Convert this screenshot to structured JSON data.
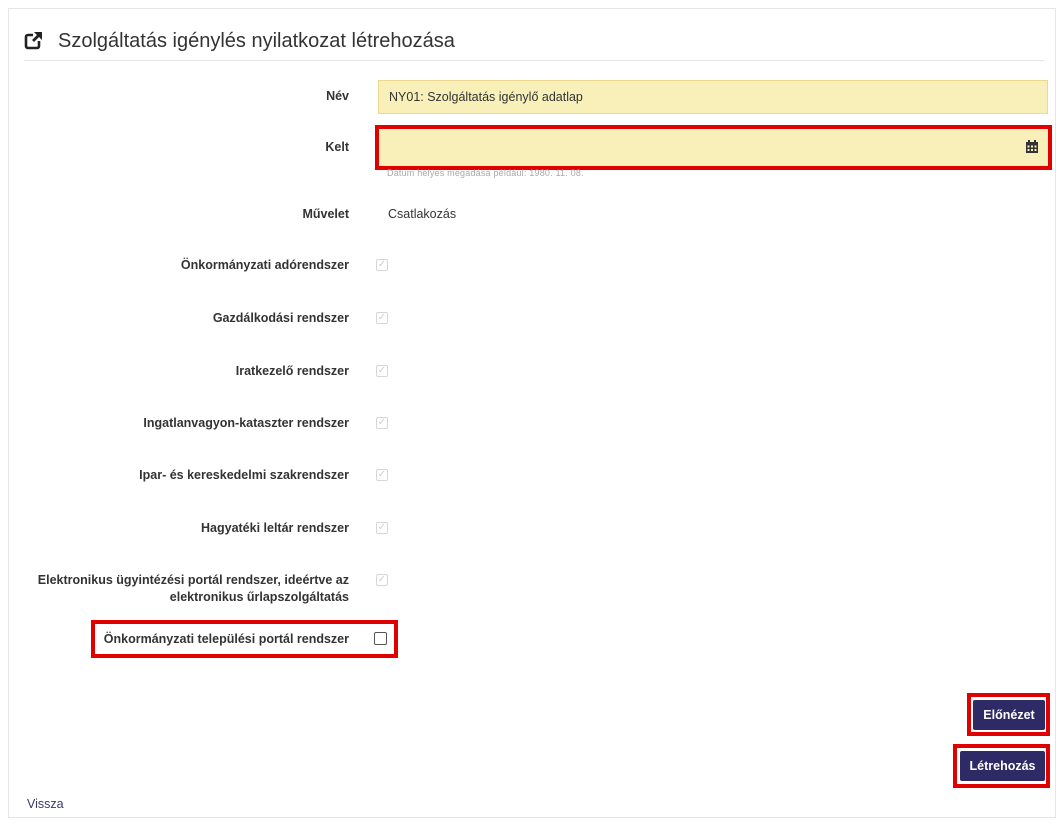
{
  "title": "Szolgáltatás igénylés nyilatkozat létrehozása",
  "fields": {
    "name_label": "Név",
    "name_value": "NY01: Szolgáltatás igénylő adatlap",
    "date_label": "Kelt",
    "date_value": "",
    "date_hint": "Dátum helyes megadása például: 1980. 11. 08.",
    "operation_label": "Művelet",
    "operation_value": "Csatlakozás"
  },
  "systems": [
    {
      "label": "Önkormányzati adórendszer",
      "checked": true,
      "disabled": true
    },
    {
      "label": "Gazdálkodási rendszer",
      "checked": true,
      "disabled": true
    },
    {
      "label": "Iratkezelő rendszer",
      "checked": true,
      "disabled": true
    },
    {
      "label": "Ingatlanvagyon-kataszter rendszer",
      "checked": true,
      "disabled": true
    },
    {
      "label": "Ipar- és kereskedelmi szakrendszer",
      "checked": true,
      "disabled": true
    },
    {
      "label": "Hagyatéki leltár rendszer",
      "checked": true,
      "disabled": true
    },
    {
      "label_line1": "Elektronikus ügyintézési portál rendszer, ideértve az",
      "label_line2": "elektronikus űrlapszolgáltatás",
      "checked": true,
      "disabled": true
    },
    {
      "label": "Önkormányzati települési portál rendszer",
      "checked": false,
      "disabled": false
    }
  ],
  "buttons": {
    "preview": "Előnézet",
    "create": "Létrehozás"
  },
  "back_link": "Vissza",
  "colors": {
    "highlight": "#e00000",
    "input_bg": "#f9efb9",
    "button_bg": "#2d2a66"
  },
  "icons": {
    "title": "external-link-icon",
    "date": "calendar-icon"
  }
}
